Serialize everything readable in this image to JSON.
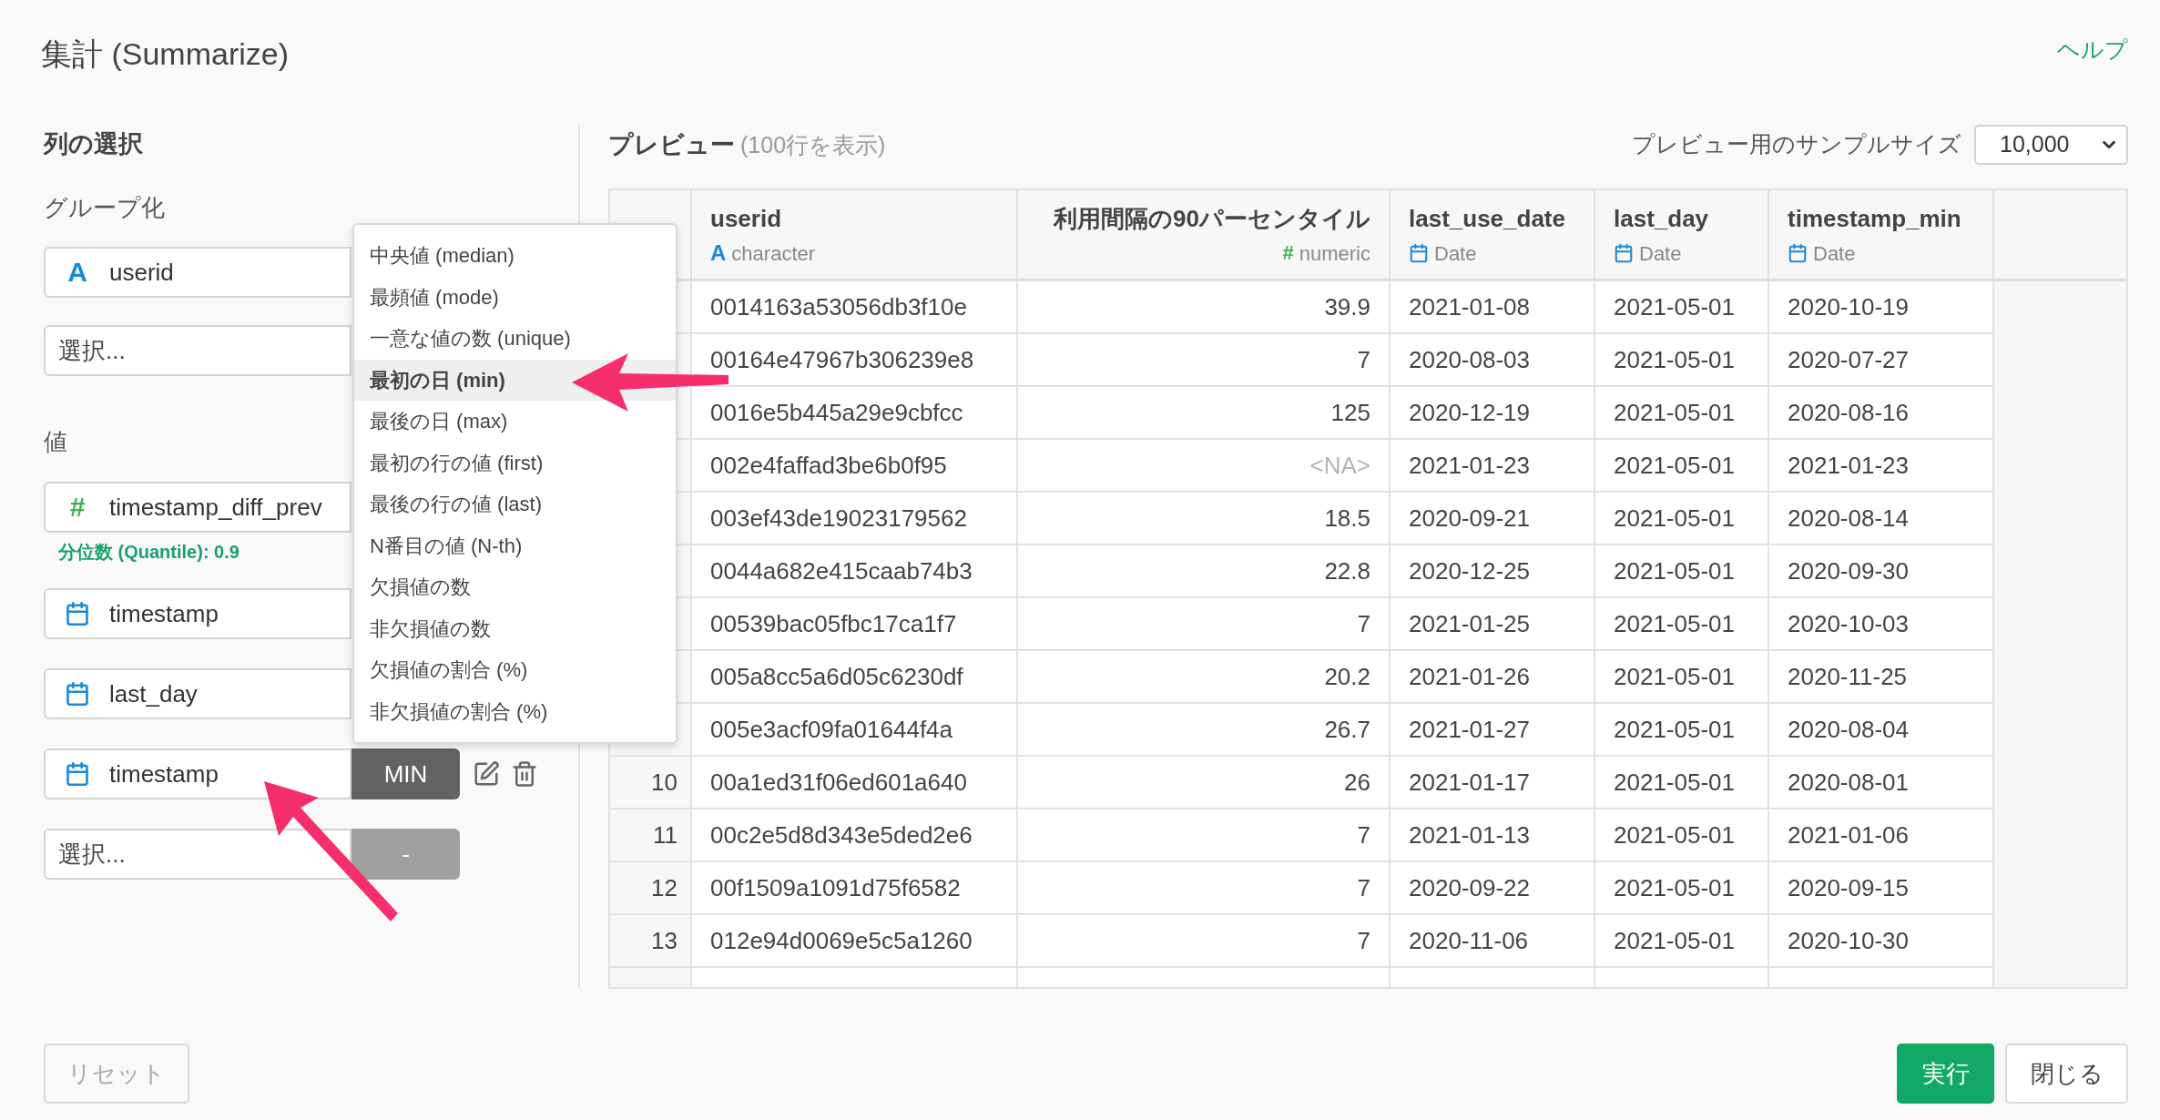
{
  "title": "集計 (Summarize)",
  "help_link": "ヘルプ",
  "column_selection": {
    "heading": "列の選択",
    "group_label": "グループ化",
    "group_fields": [
      {
        "kind": "character",
        "icon": "A",
        "column": "userid"
      },
      {
        "kind": "empty",
        "placeholder": "選択..."
      }
    ],
    "values_label": "値",
    "value_rows": [
      {
        "kind": "numeric",
        "icon": "#",
        "column": "timestamp_diff_prev",
        "note": "分位数 (Quantile): 0.9"
      },
      {
        "kind": "date",
        "column": "timestamp"
      },
      {
        "kind": "date",
        "column": "last_day"
      },
      {
        "kind": "date",
        "column": "timestamp",
        "function": "MIN",
        "disabled": false
      },
      {
        "kind": "empty",
        "placeholder": "選択...",
        "function": "-",
        "disabled": true
      }
    ]
  },
  "function_menu": {
    "items": [
      {
        "label": "中央値 (median)",
        "selected": false
      },
      {
        "label": "最頻値 (mode)",
        "selected": false
      },
      {
        "label": "一意な値の数 (unique)",
        "selected": false
      },
      {
        "label": "最初の日 (min)",
        "selected": true
      },
      {
        "label": "最後の日 (max)",
        "selected": false
      },
      {
        "label": "最初の行の値 (first)",
        "selected": false
      },
      {
        "label": "最後の行の値 (last)",
        "selected": false
      },
      {
        "label": "N番目の値 (N-th)",
        "selected": false
      },
      {
        "label": "欠損値の数",
        "selected": false
      },
      {
        "label": "非欠損値の数",
        "selected": false
      },
      {
        "label": "欠損値の割合 (%)",
        "selected": false
      },
      {
        "label": "非欠損値の割合 (%)",
        "selected": false
      }
    ]
  },
  "preview": {
    "heading": "プレビュー",
    "row_count": "(100行を表示)",
    "sample_label": "プレビュー用のサンプルサイズ",
    "sample_size": "10,000",
    "columns": [
      {
        "name": "userid",
        "type": "character",
        "kind": "character",
        "icon": "A"
      },
      {
        "name": "利用間隔の90パーセンタイル",
        "type": "numeric",
        "kind": "numeric",
        "icon": "#"
      },
      {
        "name": "last_use_date",
        "type": "Date",
        "kind": "date"
      },
      {
        "name": "last_day",
        "type": "Date",
        "kind": "date"
      },
      {
        "name": "timestamp_min",
        "type": "Date",
        "kind": "date"
      }
    ],
    "rows": [
      {
        "cells": [
          "0014163a53056db3f10e",
          "39.9",
          "2021-01-08",
          "2021-05-01",
          "2020-10-19"
        ],
        "na": false
      },
      {
        "cells": [
          "00164e47967b306239e8",
          "7",
          "2020-08-03",
          "2021-05-01",
          "2020-07-27"
        ],
        "na": false
      },
      {
        "cells": [
          "0016e5b445a29e9cbfcc",
          "125",
          "2020-12-19",
          "2021-05-01",
          "2020-08-16"
        ],
        "na": false
      },
      {
        "cells": [
          "002e4faffad3be6b0f95",
          "<NA>",
          "2021-01-23",
          "2021-05-01",
          "2021-01-23"
        ],
        "na": true
      },
      {
        "cells": [
          "003ef43de19023179562",
          "18.5",
          "2020-09-21",
          "2021-05-01",
          "2020-08-14"
        ],
        "na": false
      },
      {
        "cells": [
          "0044a682e415caab74b3",
          "22.8",
          "2020-12-25",
          "2021-05-01",
          "2020-09-30"
        ],
        "na": false
      },
      {
        "cells": [
          "00539bac05fbc17ca1f7",
          "7",
          "2021-01-25",
          "2021-05-01",
          "2020-10-03"
        ],
        "na": false
      },
      {
        "cells": [
          "005a8cc5a6d05c6230df",
          "20.2",
          "2021-01-26",
          "2021-05-01",
          "2020-11-25"
        ],
        "na": false
      },
      {
        "cells": [
          "005e3acf09fa01644f4a",
          "26.7",
          "2021-01-27",
          "2021-05-01",
          "2020-08-04"
        ],
        "na": false
      },
      {
        "index": "10",
        "cells": [
          "00a1ed31f06ed601a640",
          "26",
          "2021-01-17",
          "2021-05-01",
          "2020-08-01"
        ],
        "na": false
      },
      {
        "index": "11",
        "cells": [
          "00c2e5d8d343e5ded2e6",
          "7",
          "2021-01-13",
          "2021-05-01",
          "2021-01-06"
        ],
        "na": false
      },
      {
        "index": "12",
        "cells": [
          "00f1509a1091d75f6582",
          "7",
          "2020-09-22",
          "2021-05-01",
          "2020-09-15"
        ],
        "na": false
      },
      {
        "index": "13",
        "cells": [
          "012e94d0069e5c5a1260",
          "7",
          "2020-11-06",
          "2021-05-01",
          "2020-10-30"
        ],
        "na": false
      }
    ]
  },
  "footer": {
    "reset": "リセット",
    "run": "実行",
    "close": "閉じる"
  }
}
